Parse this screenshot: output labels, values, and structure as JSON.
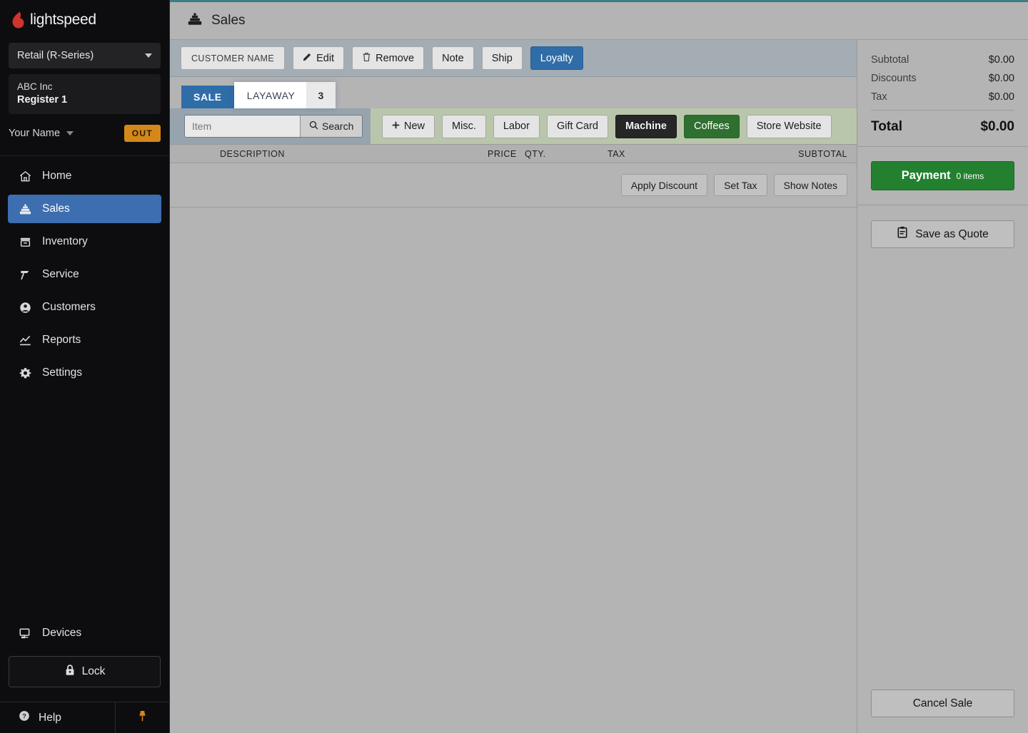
{
  "brand": {
    "name": "lightspeed",
    "logo_icon": "lightspeed-flame-icon",
    "accent": "#d0342c"
  },
  "sidebar": {
    "account_select": {
      "value": "Retail (R-Series)",
      "icon": "chevron-down-icon"
    },
    "store": {
      "company": "ABC Inc",
      "register": "Register 1"
    },
    "user": {
      "name": "Your Name",
      "status_badge": "OUT",
      "badge_color": "#d4881a",
      "icon": "chevron-down-icon"
    },
    "items": [
      {
        "label": "Home",
        "icon": "home-icon",
        "active": false
      },
      {
        "label": "Sales",
        "icon": "register-icon",
        "active": true
      },
      {
        "label": "Inventory",
        "icon": "box-icon",
        "active": false
      },
      {
        "label": "Service",
        "icon": "wrench-icon",
        "active": false
      },
      {
        "label": "Customers",
        "icon": "user-circle-icon",
        "active": false
      },
      {
        "label": "Reports",
        "icon": "chart-line-icon",
        "active": false
      },
      {
        "label": "Settings",
        "icon": "gear-icon",
        "active": false
      }
    ],
    "devices": {
      "label": "Devices",
      "icon": "monitor-icon"
    },
    "lock": {
      "label": "Lock",
      "icon": "lock-icon"
    },
    "help": {
      "label": "Help",
      "icon": "question-circle-icon"
    },
    "pin": {
      "icon": "pushpin-icon",
      "color": "#d4881a"
    },
    "active_color": "#3c6eb0"
  },
  "header": {
    "title": "Sales",
    "icon": "register-icon",
    "top_accent": "#3e7d82"
  },
  "customer_toolbar": {
    "customer_name": "CUSTOMER NAME",
    "edit": {
      "label": "Edit",
      "icon": "pencil-icon"
    },
    "remove": {
      "label": "Remove",
      "icon": "trash-icon"
    },
    "note": "Note",
    "ship": "Ship",
    "loyalty": {
      "label": "Loyalty",
      "color": "#2f6da8"
    }
  },
  "tabs": [
    {
      "label": "SALE",
      "active": true,
      "count": ""
    },
    {
      "label": "LAYAWAY",
      "active": false,
      "count": "3"
    }
  ],
  "search": {
    "placeholder": "Item",
    "value": "",
    "button_label": "Search",
    "button_icon": "search-icon"
  },
  "quick_buttons": [
    {
      "label": "New",
      "icon": "plus-icon",
      "style": "default"
    },
    {
      "label": "Misc.",
      "style": "default"
    },
    {
      "label": "Labor",
      "style": "default"
    },
    {
      "label": "Gift Card",
      "style": "default"
    },
    {
      "label": "Machine",
      "style": "dark",
      "color": "#262626"
    },
    {
      "label": "Coffees",
      "style": "green",
      "color": "#2f7030"
    },
    {
      "label": "Store Website",
      "style": "default"
    }
  ],
  "line_table": {
    "columns": [
      "DESCRIPTION",
      "PRICE",
      "QTY.",
      "TAX",
      "SUBTOTAL"
    ],
    "rows": []
  },
  "line_actions": [
    {
      "label": "Apply Discount"
    },
    {
      "label": "Set Tax"
    },
    {
      "label": "Show Notes"
    }
  ],
  "totals": {
    "rows": [
      {
        "label": "Subtotal",
        "value": "$0.00"
      },
      {
        "label": "Discounts",
        "value": "$0.00"
      },
      {
        "label": "Tax",
        "value": "$0.00"
      }
    ],
    "grand": {
      "label": "Total",
      "value": "$0.00"
    }
  },
  "actions": {
    "payment": {
      "label": "Payment",
      "items": "0 items",
      "color": "#23802f"
    },
    "save_quote": {
      "label": "Save as Quote",
      "icon": "clipboard-icon"
    },
    "cancel_sale": {
      "label": "Cancel Sale"
    }
  }
}
